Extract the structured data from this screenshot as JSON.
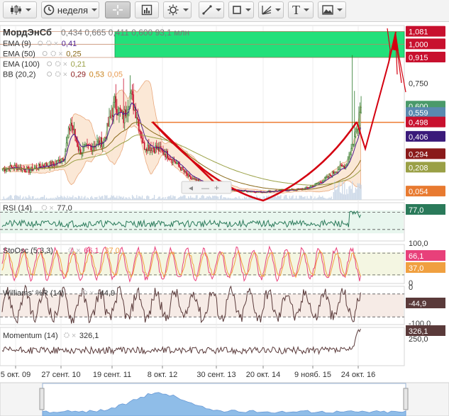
{
  "toolbar": {
    "period_label": "неделя",
    "text_tool_glyph": "T"
  },
  "legend": {
    "symbol": "МордЭнСб",
    "quote": "0,434 0,665 0,411 0,600 93,1 млн",
    "indicators": [
      {
        "name": "EMA (9)",
        "value": "0,41",
        "color": "#4b1a8c"
      },
      {
        "name": "EMA (50)",
        "value": "0,25",
        "color": "#8a6a1a"
      },
      {
        "name": "EMA (100)",
        "value": "0,21",
        "color": "#9aa046"
      },
      {
        "name": "BB (20,2)",
        "values": [
          "0,29",
          "0,53",
          "0,05"
        ],
        "colors": [
          "#8a1a1a",
          "#c8801a",
          "#e89a50"
        ]
      }
    ]
  },
  "price_axis": {
    "labels": [
      {
        "text": "1,081",
        "value": 1.081,
        "bg": "#c8102e"
      },
      {
        "text": "1,000",
        "value": 1.0,
        "bg": "#c8102e"
      },
      {
        "text": "0,915",
        "value": 0.915,
        "bg": "#c8102e"
      },
      {
        "text": "0,750",
        "value": 0.75,
        "bg": ""
      },
      {
        "text": "0,600",
        "value": 0.6,
        "bg": "#4a9a6a"
      },
      {
        "text": "0,559",
        "value": 0.559,
        "bg": "#5a8ab0"
      },
      {
        "text": "0,498",
        "value": 0.498,
        "bg": "#c8102e"
      },
      {
        "text": "0,406",
        "value": 0.406,
        "bg": "#3a1a7a"
      },
      {
        "text": "0,294",
        "value": 0.294,
        "bg": "#8a1a1a"
      },
      {
        "text": "0,208",
        "value": 0.208,
        "bg": "#9aa046"
      },
      {
        "text": "0,054",
        "value": 0.054,
        "bg": "#e87a30"
      }
    ]
  },
  "time_axis": {
    "labels": [
      "5 окт. 09",
      "27 сент. 10",
      "19 сент. 11",
      "8 окт. 12",
      "30 сент. 13",
      "20 окт. 14",
      "9 нояб. 15",
      "24 окт. 16"
    ]
  },
  "panels": {
    "rsi": {
      "title": "RSI (14)",
      "value": "77,0",
      "value_bg": "#2a7a5a",
      "line_color": "#2a7a5a",
      "fill": "#e8f6ee"
    },
    "stoch": {
      "title": "StoOsc (5,3,3)",
      "value_k": "66,1",
      "value_d": "37,0",
      "k_color": "#e8407a",
      "d_color": "#f0a040",
      "k_bg": "#e8407a",
      "d_bg": "#f0a040",
      "axis_top": "100,0",
      "axis_bottom": "0",
      "fill": "#f4f6e2"
    },
    "williams": {
      "title": "Williams' %R (14)",
      "value": "-44,9",
      "value_bg": "#5a3a3a",
      "line_color": "#5a3a3a",
      "axis_top": "0",
      "axis_bottom": "-100,0",
      "fill": "#f6ebe6"
    },
    "momentum": {
      "title": "Momentum (14)",
      "value": "326,1",
      "value_bg": "#5a3a3a",
      "line_color": "#5a3a3a",
      "axis_tick": "250,0"
    }
  },
  "colors": {
    "candle_up": "#2a7a2a",
    "candle_down": "#c8102e",
    "zone": "#22e07a",
    "drawing": "#d40010",
    "hline": "#ee7a30",
    "bb_fill": "#fbe6d2",
    "volume": "#8fbde8"
  },
  "chart_data": {
    "type": "candlestick",
    "symbol": "МордЭнСб",
    "ylim": [
      0.0,
      1.12
    ],
    "x_ticks": [
      "5 окт. 09",
      "27 сент. 10",
      "19 сент. 11",
      "8 окт. 12",
      "30 сент. 13",
      "20 окт. 14",
      "9 нояб. 15",
      "24 окт. 16"
    ],
    "close_path": [
      [
        0,
        0.2
      ],
      [
        12,
        0.21
      ],
      [
        24,
        0.19
      ],
      [
        36,
        0.22
      ],
      [
        48,
        0.23
      ],
      [
        56,
        0.28
      ],
      [
        62,
        0.5
      ],
      [
        70,
        0.31
      ],
      [
        82,
        0.35
      ],
      [
        92,
        0.38
      ],
      [
        102,
        0.62
      ],
      [
        110,
        0.52
      ],
      [
        116,
        0.68
      ],
      [
        122,
        0.55
      ],
      [
        128,
        0.35
      ],
      [
        140,
        0.33
      ],
      [
        150,
        0.29
      ],
      [
        160,
        0.22
      ],
      [
        170,
        0.14
      ],
      [
        185,
        0.1
      ],
      [
        200,
        0.07
      ],
      [
        215,
        0.06
      ],
      [
        235,
        0.05
      ],
      [
        255,
        0.06
      ],
      [
        275,
        0.07
      ],
      [
        285,
        0.1
      ],
      [
        295,
        0.14
      ],
      [
        305,
        0.2
      ],
      [
        312,
        0.22
      ],
      [
        318,
        0.35
      ],
      [
        322,
        0.45
      ],
      [
        326,
        0.6
      ]
    ],
    "close_ylim": [
      0.0,
      1.12
    ],
    "zone": {
      "top": 1.081,
      "bottom": 0.915,
      "lines": [
        1.0
      ]
    },
    "hline": 0.498,
    "rsi": {
      "ylim": [
        0,
        100
      ],
      "last": 77.0
    },
    "stoch": {
      "ylim": [
        0,
        100
      ],
      "k_last": 66.1,
      "d_last": 37.0
    },
    "williams": {
      "ylim": [
        -100,
        0
      ],
      "last": -44.9
    },
    "momentum": {
      "last": 326.1,
      "tick": 250.0
    }
  }
}
